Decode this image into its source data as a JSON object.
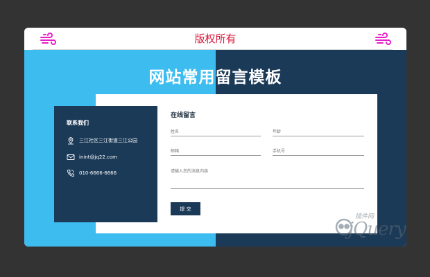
{
  "header": {
    "copyright": "版权所有",
    "left_icon": "wind-icon",
    "right_icon": "wind-icon",
    "icon_color": "#e81ec8"
  },
  "hero": {
    "title": "网站常用留言模板",
    "left_color": "#3dbcf0",
    "right_color": "#1b3a57"
  },
  "contact": {
    "title": "联系我们",
    "items": [
      {
        "icon": "map-pin-icon",
        "text": "三江社区三江街道三江公园"
      },
      {
        "icon": "mail-icon",
        "text": "inint@jq22.com"
      },
      {
        "icon": "phone-icon",
        "text": "010-6666-6666"
      }
    ]
  },
  "form": {
    "title": "在线留言",
    "fields": {
      "name_placeholder": "姓名",
      "age_placeholder": "年龄",
      "email_placeholder": "邮箱",
      "phone_placeholder": "手机号",
      "message_placeholder": "请输入您的消息内容"
    },
    "submit_label": "提 交"
  },
  "watermark": {
    "small": "插件网",
    "main": "jQuery"
  }
}
